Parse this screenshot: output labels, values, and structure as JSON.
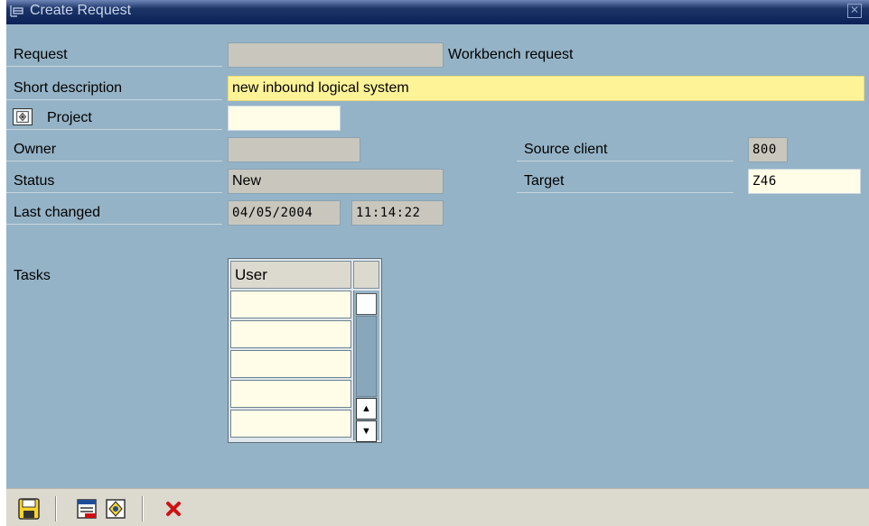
{
  "window": {
    "title": "Create Request"
  },
  "form": {
    "request": {
      "label": "Request",
      "value": "",
      "type_text": "Workbench request"
    },
    "short_description": {
      "label": "Short description",
      "value": "new inbound logical system"
    },
    "project": {
      "label": "Project",
      "value": ""
    },
    "owner": {
      "label": "Owner",
      "value": ""
    },
    "status": {
      "label": "Status",
      "value": "New"
    },
    "last_changed": {
      "label": "Last changed",
      "date": "04/05/2004",
      "time": "11:14:22"
    },
    "source_client": {
      "label": "Source client",
      "value": "800"
    },
    "target": {
      "label": "Target",
      "value": "Z46"
    }
  },
  "tasks": {
    "label": "Tasks",
    "column_header": "User",
    "rows": [
      "",
      "",
      "",
      "",
      ""
    ]
  },
  "toolbar": {
    "buttons": [
      {
        "name": "save",
        "icon": "save-icon"
      },
      {
        "name": "own-requests",
        "icon": "own-requests-icon"
      },
      {
        "name": "project-select",
        "icon": "project-icon"
      },
      {
        "name": "cancel",
        "icon": "cancel-icon"
      }
    ]
  },
  "colors": {
    "background": "#95b3c6",
    "required_field": "#fff398",
    "input_field": "#fffde8",
    "display_field": "#c9c7bd",
    "titlebar": "#0b2158",
    "cancel_red": "#d01010"
  }
}
